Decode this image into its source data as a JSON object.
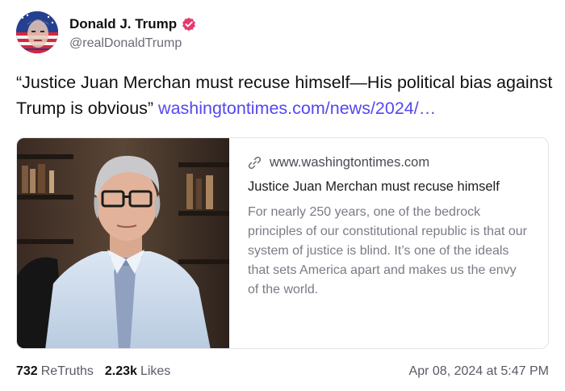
{
  "author": {
    "display_name": "Donald J. Trump",
    "handle": "@realDonaldTrump",
    "verified_icon": "verified-badge-icon",
    "badge_color": "#e8376b"
  },
  "post": {
    "text": "“Justice Juan Merchan must recuse himself—His political bias against Trump is obvious”",
    "link_text": "washingtontimes.com/news/2024/…",
    "link_color": "#5448ee"
  },
  "card": {
    "domain": "www.washingtontimes.com",
    "title": "Justice Juan Merchan must recuse himself",
    "description": "For nearly 250 years, one of the bedrock principles of our constitutional republic is that our system of justice is blind. It’s one of the ideals that sets America apart and makes us the envy of the world."
  },
  "stats": {
    "retruths_count": "732",
    "retruths_label": "ReTruths",
    "likes_count": "2.23k",
    "likes_label": "Likes"
  },
  "timestamp": "Apr 08, 2024 at 5:47 PM"
}
